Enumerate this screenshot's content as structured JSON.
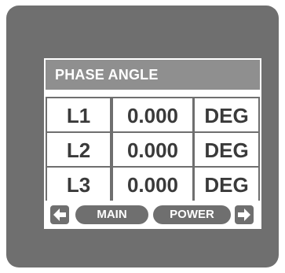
{
  "screen": {
    "title": "PHASE ANGLE",
    "rows": [
      {
        "phase": "L1",
        "value": "0.000",
        "unit": "DEG"
      },
      {
        "phase": "L2",
        "value": "0.000",
        "unit": "DEG"
      },
      {
        "phase": "L3",
        "value": "0.000",
        "unit": "DEG"
      }
    ]
  },
  "nav": {
    "prev_icon": "arrow-left-icon",
    "main_label": "MAIN",
    "power_label": "POWER",
    "next_icon": "arrow-right-icon"
  },
  "colors": {
    "bezel": "#6f6f6f",
    "title_bar": "#8f8f8f",
    "text": "#3a3a3a"
  }
}
